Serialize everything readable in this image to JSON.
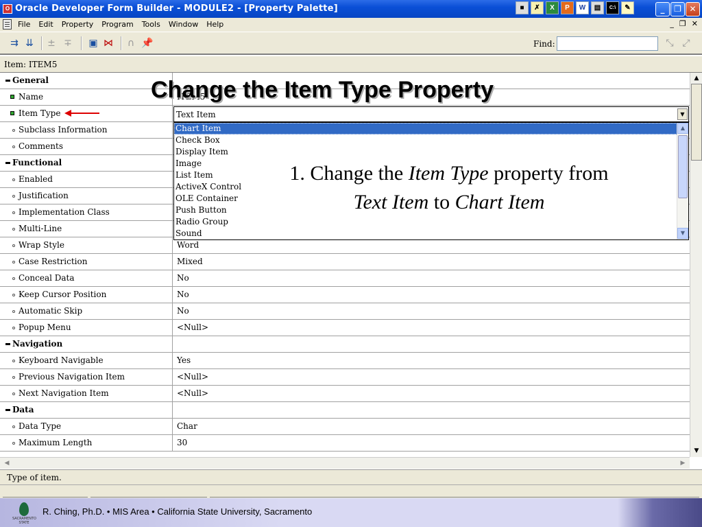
{
  "window": {
    "title": "Oracle Developer Form Builder - MODULE2 - [Property Palette]",
    "app_icon": "oracle-app-icon",
    "tray_icons": [
      "network-icon",
      "pinned-app-icon",
      "excel-icon",
      "powerpoint-icon",
      "word-icon",
      "file-icon",
      "terminal-icon",
      "notes-icon"
    ],
    "tray_labels": [
      "",
      "",
      "X",
      "P",
      "W",
      "",
      "C:\\",
      ""
    ]
  },
  "menu": {
    "items": [
      "File",
      "Edit",
      "Property",
      "Program",
      "Tools",
      "Window",
      "Help"
    ]
  },
  "toolbar": {
    "icons": [
      "copy-properties-icon",
      "paste-properties-icon",
      "add-property-icon",
      "delete-property-icon",
      "property-class-icon",
      "inherit-icon",
      "intersection-icon",
      "freeze-icon"
    ],
    "find_label": "Find:",
    "find_value": ""
  },
  "context_label": "Item: ITEM5",
  "properties": {
    "general_header": "General",
    "name_label": "Name",
    "name_value": "ITEM5",
    "item_type_label": "Item Type",
    "item_type_value": "Text Item",
    "subclass_label": "Subclass Information",
    "comments_label": "Comments",
    "functional_header": "Functional",
    "enabled_label": "Enabled",
    "justification_label": "Justification",
    "impl_class_label": "Implementation Class",
    "multiline_label": "Multi-Line",
    "wrap_label": "Wrap Style",
    "wrap_value": "Word",
    "case_label": "Case Restriction",
    "case_value": "Mixed",
    "conceal_label": "Conceal Data",
    "conceal_value": "No",
    "keep_cursor_label": "Keep Cursor Position",
    "keep_cursor_value": "No",
    "auto_skip_label": "Automatic Skip",
    "auto_skip_value": "No",
    "popup_label": "Popup Menu",
    "popup_value": "<Null>",
    "navigation_header": "Navigation",
    "kbd_nav_label": "Keyboard Navigable",
    "kbd_nav_value": "Yes",
    "prev_nav_label": "Previous Navigation Item",
    "prev_nav_value": "<Null>",
    "next_nav_label": "Next Navigation Item",
    "next_nav_value": "<Null>",
    "data_header": "Data",
    "data_type_label": "Data Type",
    "data_type_value": "Char",
    "max_len_label": "Maximum Length",
    "max_len_value": "30"
  },
  "item_type_options": [
    "Chart Item",
    "Check Box",
    "Display Item",
    "Image",
    "List Item",
    "ActiveX Control",
    "OLE Container",
    "Push Button",
    "Radio Group",
    "Sound"
  ],
  "item_type_highlighted": "Chart Item",
  "hint_text": "Type of item.",
  "slide": {
    "title": "Change the Item Type Property",
    "instruction_prefix": "1. Change the ",
    "instruction_em1": "Item Type",
    "instruction_mid": " property from ",
    "instruction_em2": "Text Item",
    "instruction_to": " to ",
    "instruction_em3": "Chart Item",
    "footer_credit": "R. Ching, Ph.D. • MIS Area  • California State University, Sacramento",
    "logo_caption": "SACRAMENTO STATE",
    "arrow_color": "#dd0000"
  },
  "colors": {
    "titlebar": "#0a4fd6",
    "selection": "#316ac5",
    "chrome": "#ece9d8"
  }
}
